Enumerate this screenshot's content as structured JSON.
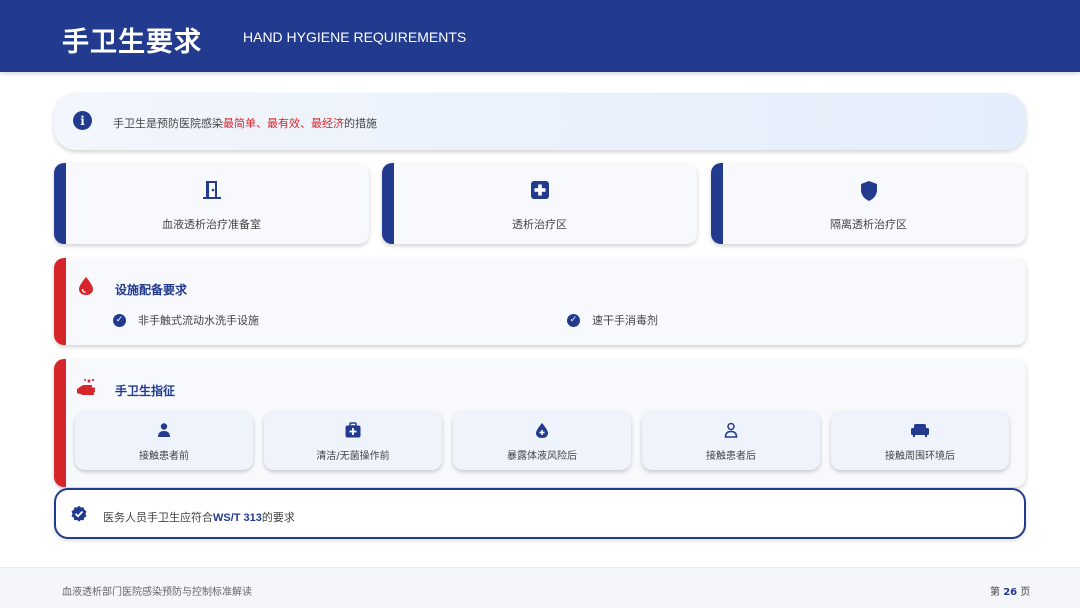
{
  "header": {
    "title_cn": "手卫生要求",
    "title_en": "HAND HYGIENE REQUIREMENTS"
  },
  "info": {
    "icon": "info-icon",
    "text_prefix": "手卫生是预防医院感染",
    "highlight_1": "最简单",
    "sep_1": "、",
    "highlight_2": "最有效",
    "sep_2": "、",
    "highlight_3": "最经济",
    "text_suffix": "的措施"
  },
  "areas": [
    {
      "label": "血液透析治疗准备室",
      "icon": "door-icon"
    },
    {
      "label": "透析治疗区",
      "icon": "medical-plus-icon"
    },
    {
      "label": "隔离透析治疗区",
      "icon": "shield-icon"
    }
  ],
  "facilities": {
    "title": "设施配备要求",
    "icon": "droplet-icon",
    "items": [
      "非手触式流动水洗手设施",
      "速干手消毒剂"
    ]
  },
  "indications": {
    "title": "手卫生指征",
    "icon": "hand-wash-icon",
    "moments": [
      {
        "label": "接触患者前",
        "icon": "user-icon"
      },
      {
        "label": "清洁/无菌操作前",
        "icon": "medkit-icon"
      },
      {
        "label": "暴露体液风险后",
        "icon": "blood-drop-icon"
      },
      {
        "label": "接触患者后",
        "icon": "user-outline-icon"
      },
      {
        "label": "接触周围环境后",
        "icon": "couch-icon"
      }
    ]
  },
  "standard": {
    "icon": "badge-check-icon",
    "prefix": "医务人员手卫生应符合",
    "code": "WS/T 313",
    "suffix": "的要求"
  },
  "footer": {
    "left": "血液透析部门医院感染预防与控制标准解读",
    "page_prefix": "第",
    "page_num": "26",
    "page_suffix": "页"
  },
  "colors": {
    "primary": "#223b8f",
    "accent_red": "#d7262b"
  }
}
